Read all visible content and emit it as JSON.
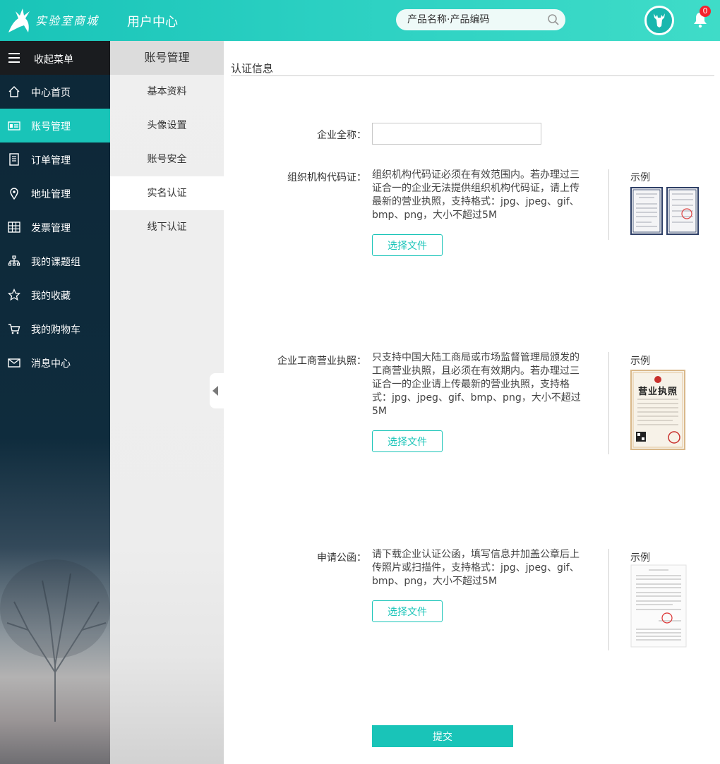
{
  "header": {
    "logo_text": "实验室商城",
    "title": "用户中心",
    "search_placeholder": "产品名称·产品编码",
    "notification_count": "0"
  },
  "nav": {
    "collapse_label": "收起菜单",
    "items": [
      {
        "label": "中心首页",
        "icon": "home-icon"
      },
      {
        "label": "账号管理",
        "icon": "id-card-icon",
        "active": true
      },
      {
        "label": "订单管理",
        "icon": "document-icon"
      },
      {
        "label": "地址管理",
        "icon": "location-pin-icon"
      },
      {
        "label": "发票管理",
        "icon": "table-icon"
      },
      {
        "label": "我的课题组",
        "icon": "org-chart-icon"
      },
      {
        "label": "我的收藏",
        "icon": "star-icon"
      },
      {
        "label": "我的购物车",
        "icon": "cart-icon"
      },
      {
        "label": "消息中心",
        "icon": "envelope-icon"
      }
    ]
  },
  "subnav": {
    "title": "账号管理",
    "items": [
      {
        "label": "基本资料"
      },
      {
        "label": "头像设置"
      },
      {
        "label": "账号安全"
      },
      {
        "label": "实名认证",
        "active": true
      },
      {
        "label": "线下认证"
      }
    ]
  },
  "main": {
    "title": "认证信息",
    "company_name_label": "企业全称：",
    "company_name_value": "",
    "sections": [
      {
        "label": "组织机构代码证：",
        "description": "组织机构代码证必须在有效范围内。若办理过三证合一的企业无法提供组织机构代码证，请上传最新的营业执照，支持格式：jpg、jpeg、gif、bmp、png，大小不超过5M",
        "button": "选择文件",
        "example_label": "示例"
      },
      {
        "label": "企业工商营业执照：",
        "description": "只支持中国大陆工商局或市场监督管理局颁发的工商营业执照，且必须在有效期内。若办理过三证合一的企业请上传最新的营业执照，支持格式：jpg、jpeg、gif、bmp、png，大小不超过5M",
        "button": "选择文件",
        "example_label": "示例",
        "example_title": "营业执照"
      },
      {
        "label": "申请公函：",
        "description": "请下载企业认证公函，填写信息并加盖公章后上传照片或扫描件，支持格式：jpg、jpeg、gif、bmp、png，大小不超过5M",
        "button": "选择文件",
        "example_label": "示例"
      }
    ],
    "submit_label": "提交"
  },
  "colors": {
    "accent": "#19c4b8",
    "nav_dark": "#0d2737",
    "badge_red": "#f5222d"
  }
}
